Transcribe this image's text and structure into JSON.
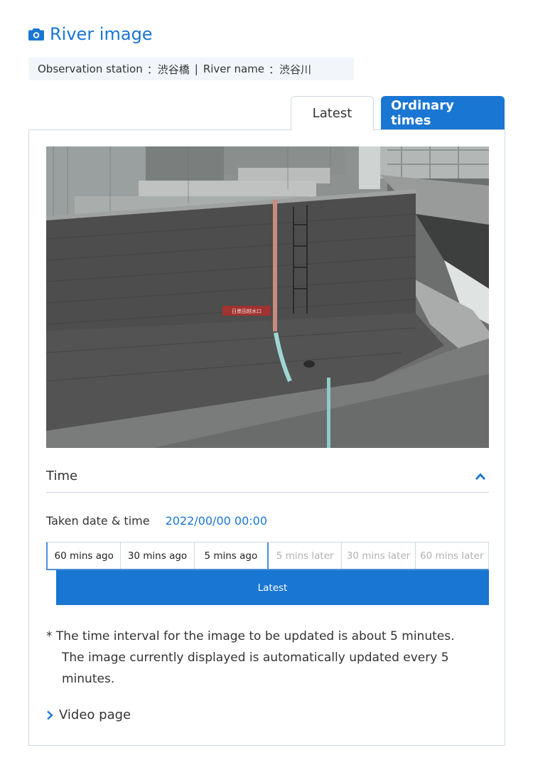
{
  "header": {
    "title": "River image",
    "icon": "camera-icon"
  },
  "station": {
    "station_label": "Observation station",
    "station_value": "：渋谷橋",
    "separator": "|",
    "river_label": "River name",
    "river_value": "：渋谷川"
  },
  "tabs": [
    {
      "label": "Latest",
      "active": true
    },
    {
      "label": "Ordinary times",
      "active": false
    }
  ],
  "camera": {
    "alt": "River camera image of concrete riverbank wall",
    "sign_text": "日墨田越水口"
  },
  "time_section": {
    "title": "Time",
    "toggle_icon": "chevron-up-icon",
    "taken_label": "Taken date & time",
    "taken_value": "2022/00/00 00:00",
    "segments": [
      {
        "label": "60 mins ago",
        "enabled": true
      },
      {
        "label": "30 mins ago",
        "enabled": true
      },
      {
        "label": "5 mins ago",
        "enabled": true
      },
      {
        "label": "5 mins later",
        "enabled": false
      },
      {
        "label": "30 mins later",
        "enabled": false
      },
      {
        "label": "60 mins later",
        "enabled": false
      }
    ],
    "latest_label": "Latest"
  },
  "note": {
    "line1": "* The time interval for the image to be updated is about 5 minutes.",
    "line2": "The image currently displayed is automatically updated every 5 minutes."
  },
  "video_link": {
    "label": "Video page",
    "icon": "chevron-right-icon"
  },
  "colors": {
    "accent": "#1976d2",
    "border": "#cfd8e1",
    "station_bg": "#f2f6fa",
    "disabled_text": "#b0b0b0"
  }
}
